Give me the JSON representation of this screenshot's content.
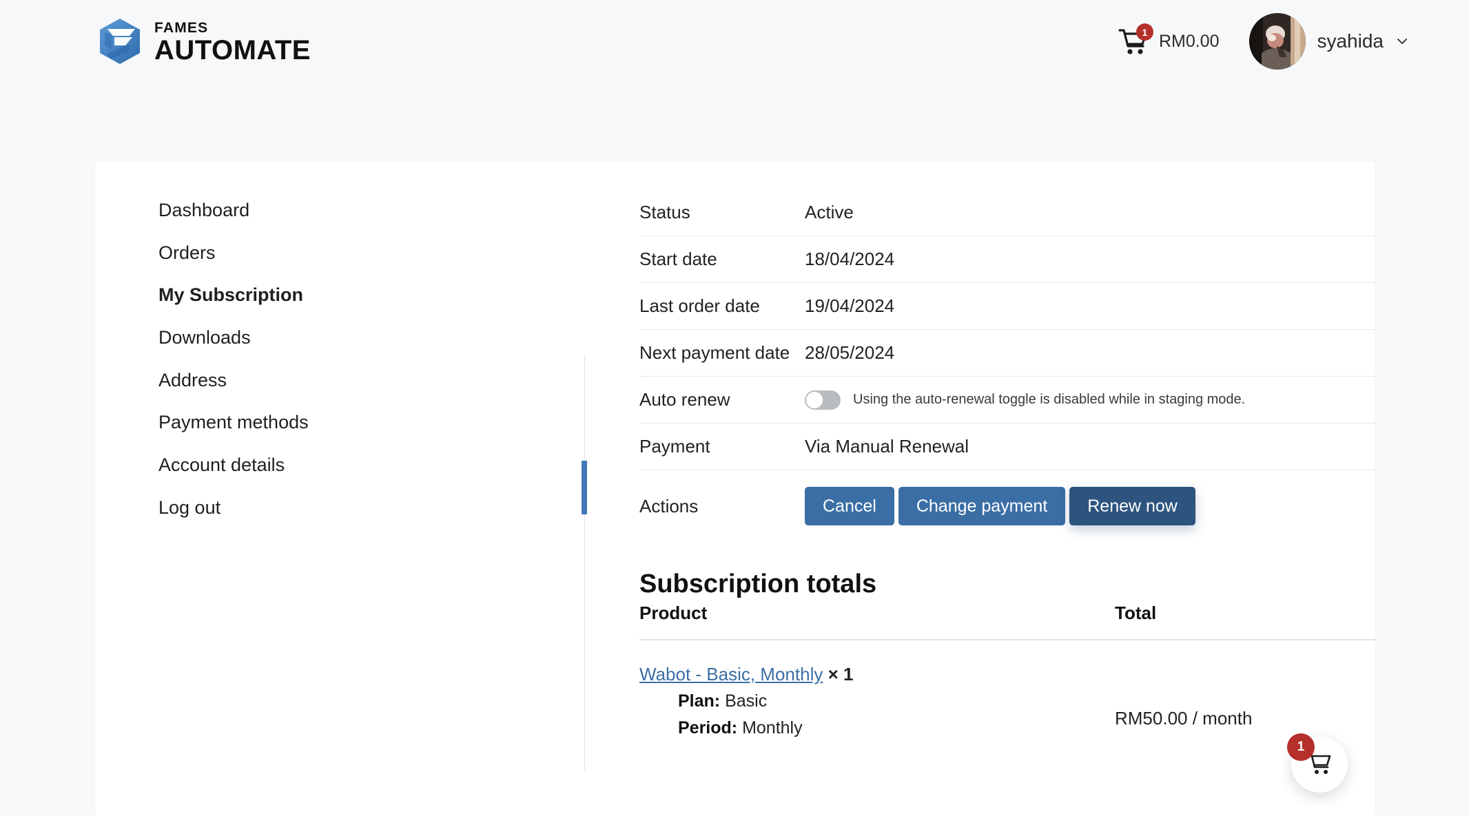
{
  "header": {
    "logo": {
      "mark_icon": "fames-hexagon-logo-icon",
      "top_word": "FAMES",
      "bottom_word": "AUTOMATE"
    },
    "cart": {
      "icon": "shopping-cart-icon",
      "badge_count": "1",
      "amount": "RM0.00"
    },
    "user": {
      "avatar_icon": "user-avatar",
      "name": "syahida",
      "chevron_icon": "chevron-down-icon"
    }
  },
  "sidebar": {
    "items": [
      {
        "label": "Dashboard",
        "active": false
      },
      {
        "label": "Orders",
        "active": false
      },
      {
        "label": "My Subscription",
        "active": true
      },
      {
        "label": "Downloads",
        "active": false
      },
      {
        "label": "Address",
        "active": false
      },
      {
        "label": "Payment methods",
        "active": false
      },
      {
        "label": "Account details",
        "active": false
      },
      {
        "label": "Log out",
        "active": false
      }
    ],
    "active_accent_color": "#4477b8"
  },
  "subscription": {
    "rows": [
      {
        "label": "Status",
        "value": "Active"
      },
      {
        "label": "Start date",
        "value": "18/04/2024"
      },
      {
        "label": "Last order date",
        "value": "19/04/2024"
      },
      {
        "label": "Next payment date",
        "value": "28/05/2024"
      }
    ],
    "auto_renew": {
      "label": "Auto renew",
      "toggle_state": "off",
      "note": "Using the auto-renewal toggle is disabled while in staging mode."
    },
    "payment": {
      "label": "Payment",
      "value": "Via Manual Renewal"
    },
    "actions": {
      "label": "Actions",
      "buttons": [
        {
          "label": "Cancel",
          "style": "primary"
        },
        {
          "label": "Change payment",
          "style": "primary"
        },
        {
          "label": "Renew now",
          "style": "primary-hover"
        }
      ],
      "primary_color": "#3b6ea5",
      "primary_hover_color": "#2d547f"
    }
  },
  "totals": {
    "heading": "Subscription totals",
    "columns": {
      "product": "Product",
      "total": "Total"
    },
    "row": {
      "product_name": "Wabot - Basic, Monthly",
      "qty_separator": "×",
      "qty": "1",
      "plan_label": "Plan:",
      "plan_value": "Basic",
      "period_label": "Period:",
      "period_value": "Monthly",
      "total": "RM50.00 / month"
    }
  },
  "floating_cart": {
    "icon": "shopping-cart-icon",
    "badge_count": "1",
    "badge_color": "#b5302b"
  }
}
